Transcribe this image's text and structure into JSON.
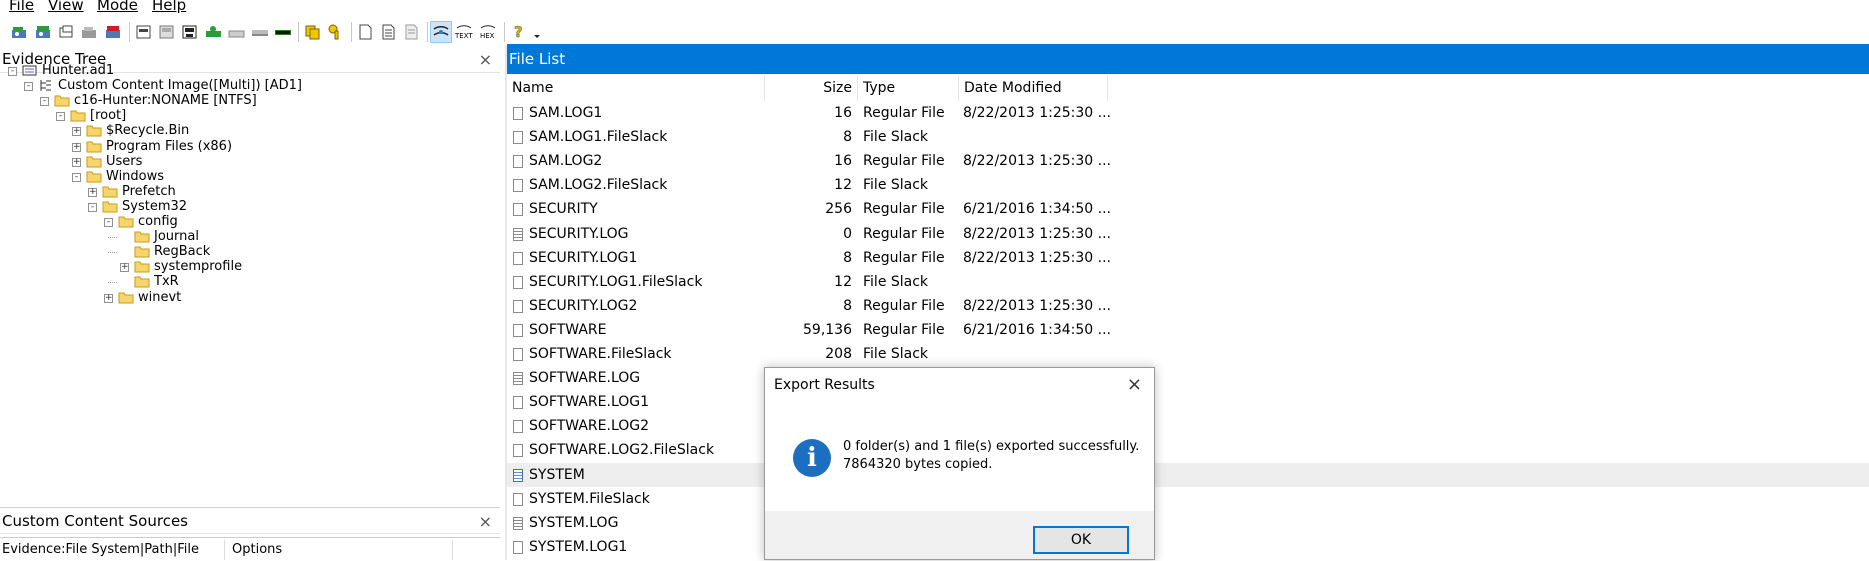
{
  "menu": [
    "File",
    "View",
    "Mode",
    "Help"
  ],
  "toolbar": {
    "icons": [
      "add-evidence-icon",
      "add-all-evidence-icon",
      "image-mounting-icon",
      "remove-evidence-icon",
      "remove-all-evidence-icon",
      "create-disk-image-icon",
      "export-disk-image-icon",
      "capture-memory-icon",
      "obtain-protected-files-icon",
      "detect-encryption-icon",
      "ad-encryption-icon",
      "verify-drive-icon",
      "image-mount-icon",
      "decrypt-ad1-icon",
      "export-files-icon",
      "export-file-hash-list-icon",
      "add-to-custom-content-icon",
      "create-custom-content-image-icon",
      "auto-view-icon",
      "text-view-icon",
      "hex-view-icon",
      "help-icon",
      "dropdown-arrow-icon"
    ],
    "text_label": "TEXT",
    "hex_label": "HEX"
  },
  "evidence_tree": {
    "title": "Evidence Tree",
    "close": "×",
    "nodes": [
      {
        "label": "Hunter.ad1"
      },
      {
        "label": "Custom Content Image([Multi]) [AD1]"
      },
      {
        "label": "c16-Hunter:NONAME [NTFS]"
      },
      {
        "label": "[root]"
      },
      {
        "label": "$Recycle.Bin"
      },
      {
        "label": "Program Files (x86)"
      },
      {
        "label": "Users"
      },
      {
        "label": "Windows"
      },
      {
        "label": "Prefetch"
      },
      {
        "label": "System32"
      },
      {
        "label": "config"
      },
      {
        "label": "Journal"
      },
      {
        "label": "RegBack"
      },
      {
        "label": "systemprofile"
      },
      {
        "label": "TxR"
      },
      {
        "label": "winevt"
      }
    ]
  },
  "custom_content": {
    "title": "Custom Content Sources",
    "close": "×",
    "columns": [
      "Evidence:File System|Path|File",
      "Options"
    ]
  },
  "file_list": {
    "title": "File List",
    "columns": [
      "Name",
      "Size",
      "Type",
      "Date Modified"
    ],
    "rows": [
      {
        "name": "SAM.LOG1",
        "size": "16",
        "type": "Regular File",
        "date": "8/22/2013 1:25:30 ..."
      },
      {
        "name": "SAM.LOG1.FileSlack",
        "size": "8",
        "type": "File Slack",
        "date": ""
      },
      {
        "name": "SAM.LOG2",
        "size": "16",
        "type": "Regular File",
        "date": "8/22/2013 1:25:30 ..."
      },
      {
        "name": "SAM.LOG2.FileSlack",
        "size": "12",
        "type": "File Slack",
        "date": ""
      },
      {
        "name": "SECURITY",
        "size": "256",
        "type": "Regular File",
        "date": "6/21/2016 1:34:50 ..."
      },
      {
        "name": "SECURITY.LOG",
        "size": "0",
        "type": "Regular File",
        "date": "8/22/2013 1:25:30 ..."
      },
      {
        "name": "SECURITY.LOG1",
        "size": "8",
        "type": "Regular File",
        "date": "8/22/2013 1:25:30 ..."
      },
      {
        "name": "SECURITY.LOG1.FileSlack",
        "size": "12",
        "type": "File Slack",
        "date": ""
      },
      {
        "name": "SECURITY.LOG2",
        "size": "8",
        "type": "Regular File",
        "date": "8/22/2013 1:25:30 ..."
      },
      {
        "name": "SOFTWARE",
        "size": "59,136",
        "type": "Regular File",
        "date": "6/21/2016 1:34:50 ..."
      },
      {
        "name": "SOFTWARE.FileSlack",
        "size": "208",
        "type": "File Slack",
        "date": ""
      },
      {
        "name": "SOFTWARE.LOG",
        "size": "",
        "type": "",
        "date": ""
      },
      {
        "name": "SOFTWARE.LOG1",
        "size": "",
        "type": "",
        "date": ""
      },
      {
        "name": "SOFTWARE.LOG2",
        "size": "",
        "type": "",
        "date": ""
      },
      {
        "name": "SOFTWARE.LOG2.FileSlack",
        "size": "",
        "type": "",
        "date": ""
      },
      {
        "name": "SYSTEM",
        "size": "",
        "type": "",
        "date": ""
      },
      {
        "name": "SYSTEM.FileSlack",
        "size": "",
        "type": "",
        "date": ""
      },
      {
        "name": "SYSTEM.LOG",
        "size": "",
        "type": "",
        "date": ""
      },
      {
        "name": "SYSTEM.LOG1",
        "size": "",
        "type": "",
        "date": ""
      }
    ]
  },
  "dialog": {
    "title": "Export Results",
    "close": "×",
    "icon": "i",
    "message_line1": "0 folder(s) and 1 file(s) exported successfully.",
    "message_line2": "7864320 bytes copied.",
    "ok_label": "OK"
  }
}
